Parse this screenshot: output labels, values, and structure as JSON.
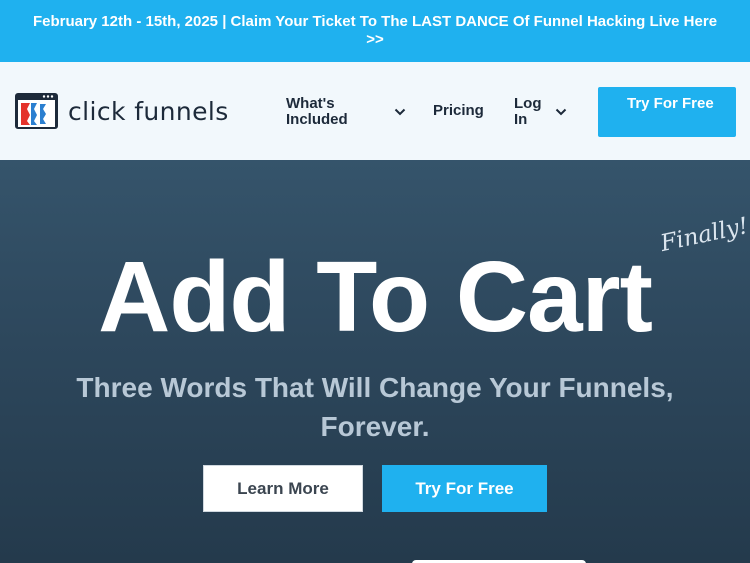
{
  "promo": {
    "text": "February 12th - 15th, 2025 | Claim Your Ticket To The LAST DANCE Of Funnel Hacking Live Here >>"
  },
  "header": {
    "logo_text": "click funnels",
    "nav": {
      "whats_included": "What's Included",
      "pricing": "Pricing",
      "login": "Log In"
    },
    "cta_label": "Try For Free"
  },
  "hero": {
    "finally": "Finally!",
    "title": "Add To Cart",
    "subtitle": "Three Words That Will Change Your Funnels, Forever.",
    "learn_more": "Learn More",
    "try_free": "Try For Free"
  },
  "colors": {
    "accent": "#1fb1ef",
    "header_bg": "#f2f8fc",
    "hero_bg": "#2f4a5f",
    "logo_red": "#e4322b",
    "logo_blue": "#2b7fd0",
    "text_dark": "#1d2a3a"
  },
  "icons": {
    "logo": "clickfunnels-logo-icon",
    "dropdown": "chevron-down-icon"
  }
}
